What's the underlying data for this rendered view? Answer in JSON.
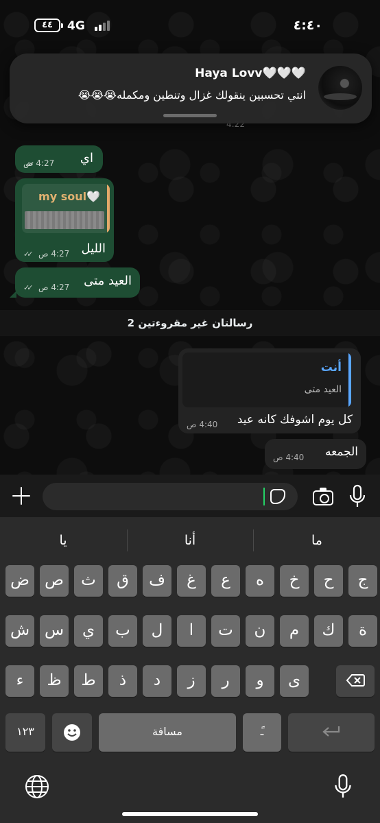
{
  "status_bar": {
    "battery": "٤٤",
    "network": "4G",
    "time": "٤:٤٠"
  },
  "notification": {
    "sender": "Haya Lovv🤍🤍🤍",
    "text": "انتي تحسبين ينقولك غزال وتنطين ومكمله😭😭😭",
    "partial_time": "4:22"
  },
  "messages": [
    {
      "text": "اي",
      "time": "4:27 ص",
      "direction": "outgoing",
      "status": "read"
    },
    {
      "quote_name": "my soul🤍",
      "text": "الليل",
      "time": "4:27 ص",
      "direction": "outgoing",
      "status": "read"
    },
    {
      "text": "العيد متى",
      "time": "4:27 ص",
      "direction": "outgoing",
      "status": "read"
    },
    {
      "reply_name": "أنت",
      "reply_text": "العيد متى",
      "text": "كل يوم اشوفك كانه عيد",
      "time": "4:40 ص",
      "direction": "incoming"
    },
    {
      "text": "الجمعه",
      "time": "4:40 ص",
      "direction": "incoming"
    }
  ],
  "unread_banner": "2 رسالتان غير مقروءتين",
  "input": {
    "placeholder": ""
  },
  "keyboard": {
    "suggestions": [
      "يا",
      "أنا",
      "ما"
    ],
    "row1": [
      "ض",
      "ص",
      "ث",
      "ق",
      "ف",
      "غ",
      "ع",
      "ه",
      "خ",
      "ح",
      "ج"
    ],
    "row2": [
      "ش",
      "س",
      "ي",
      "ب",
      "ل",
      "ا",
      "ت",
      "ن",
      "م",
      "ك",
      "ة"
    ],
    "row3": [
      "ء",
      "ظ",
      "ط",
      "ذ",
      "د",
      "ز",
      "ر",
      "و",
      "ى"
    ],
    "numbers_key": "١٢٣",
    "space_key": "مسافة",
    "diacritic_key": "ًـ"
  },
  "colors": {
    "outgoing_bubble": "#1e4d33",
    "incoming_bubble": "#232323",
    "reply_accent": "#5aa7ff",
    "quote_accent": "#e4a96a"
  }
}
